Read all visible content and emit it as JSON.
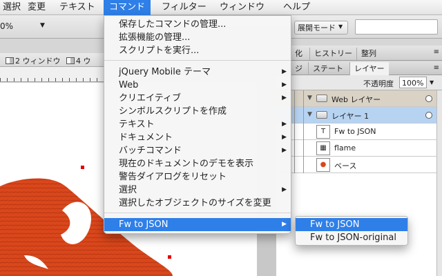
{
  "menubar": {
    "items": [
      "選択",
      "変更",
      "テキスト",
      "コマンド",
      "フィルター",
      "ウィンドウ",
      "ヘルプ"
    ],
    "active_index": 3,
    "accent_color": "#2e7fe8"
  },
  "toolbar": {
    "zoom_value": "0%",
    "mode_label": "展開モード",
    "search_placeholder": ""
  },
  "window_controls": {
    "items": [
      "2 ウィンドウ",
      "4 ウ"
    ]
  },
  "commands_menu": {
    "items": [
      {
        "label": "保存したコマンドの管理...",
        "submenu": false
      },
      {
        "label": "拡張機能の管理...",
        "submenu": false
      },
      {
        "label": "スクリプトを実行...",
        "submenu": false
      },
      {
        "label": "jQuery Mobile テーマ",
        "submenu": true
      },
      {
        "label": "Web",
        "submenu": true
      },
      {
        "label": "クリエイティブ",
        "submenu": true
      },
      {
        "label": "シンボルスクリプトを作成",
        "submenu": false
      },
      {
        "label": "テキスト",
        "submenu": true
      },
      {
        "label": "ドキュメント",
        "submenu": true
      },
      {
        "label": "バッチコマンド",
        "submenu": true
      },
      {
        "label": "現在のドキュメントのデモを表示",
        "submenu": false
      },
      {
        "label": "警告ダイアログをリセット",
        "submenu": false
      },
      {
        "label": "選択",
        "submenu": true
      },
      {
        "label": "選択したオブジェクトのサイズを変更",
        "submenu": false
      },
      {
        "label": "Fw to JSON",
        "submenu": true
      }
    ],
    "highlighted_index": 14
  },
  "fw_to_json_submenu": {
    "items": [
      "Fw to JSON",
      "Fw to JSON-original"
    ],
    "highlighted_index": 0
  },
  "panels": {
    "top_tabs": [
      "化",
      "ヒストリー",
      "整列"
    ],
    "tabs": [
      "ジ",
      "ステート",
      "レイヤー"
    ],
    "selected_tab_index": 2,
    "opacity_label": "不透明度",
    "opacity_value": "100%"
  },
  "layers": [
    {
      "name": "Web レイヤー",
      "type": "group"
    },
    {
      "name": "レイヤー 1",
      "type": "group-selected"
    },
    {
      "name": "Fw to JSON",
      "type": "object",
      "thumb": "T"
    },
    {
      "name": "flame",
      "type": "object",
      "thumb": "▦"
    },
    {
      "name": "ベース",
      "type": "object",
      "thumb": "●"
    }
  ],
  "canvas": {
    "art_color": "#d9471c"
  }
}
